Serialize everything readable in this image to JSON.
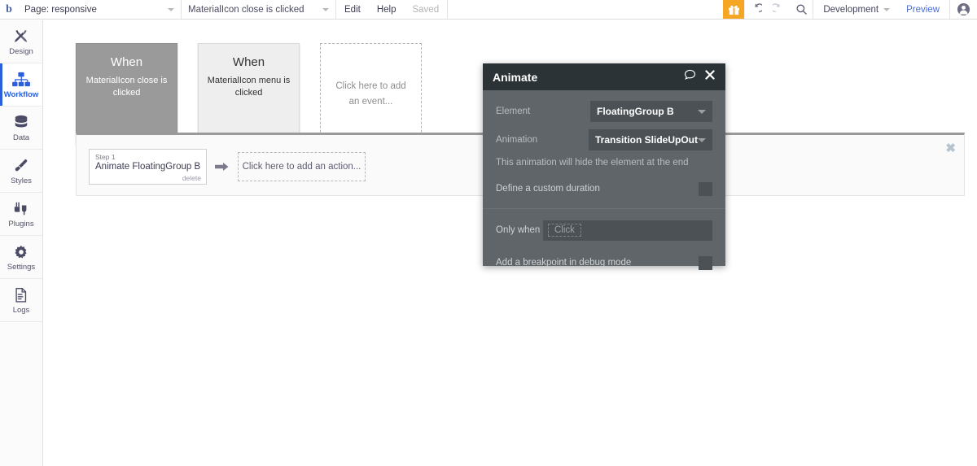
{
  "topbar": {
    "logo": "b",
    "page_select": {
      "label": "Page: responsive",
      "caret": "chevron-down-icon"
    },
    "event_select": {
      "label": "MaterialIcon close is clicked",
      "caret": "chevron-down-icon"
    },
    "edit": "Edit",
    "help": "Help",
    "saved": "Saved",
    "gift_icon": "gift-icon",
    "undo_icon": "undo-icon",
    "redo_icon": "redo-icon",
    "search_icon": "search-icon",
    "version": "Development",
    "preview": "Preview",
    "avatar_icon": "account-avatar-icon"
  },
  "sidebar": {
    "items": [
      {
        "label": "Design",
        "icon": "design-icon",
        "active": false
      },
      {
        "label": "Workflow",
        "icon": "workflow-icon",
        "active": true
      },
      {
        "label": "Data",
        "icon": "data-icon",
        "active": false
      },
      {
        "label": "Styles",
        "icon": "styles-icon",
        "active": false
      },
      {
        "label": "Plugins",
        "icon": "plugins-icon",
        "active": false
      },
      {
        "label": "Settings",
        "icon": "settings-icon",
        "active": false
      },
      {
        "label": "Logs",
        "icon": "logs-icon",
        "active": false
      }
    ],
    "expand_icon": "expand-sidebar-icon"
  },
  "workflow": {
    "events": [
      {
        "when": "When",
        "description": "MaterialIcon close is clicked",
        "selected": true
      },
      {
        "when": "When",
        "description": "MaterialIcon menu is clicked",
        "selected": false
      }
    ],
    "add_event_placeholder": "Click here to add an event...",
    "actions": {
      "step_number": "Step 1",
      "step_title": "Animate FloatingGroup B",
      "delete_label": "delete",
      "arrow_icon": "arrow-right-icon",
      "add_action_placeholder": "Click here to add an action...",
      "close_icon": "close-icon"
    }
  },
  "animate_popup": {
    "title": "Animate",
    "comment_icon": "comment-bubble-icon",
    "close_icon": "close-icon",
    "element_label": "Element",
    "element_value": "FloatingGroup B",
    "animation_label": "Animation",
    "animation_value": "Transition SlideUpOut",
    "hint": "This animation will hide the element at the end",
    "custom_duration_label": "Define a custom duration",
    "custom_duration_checked": false,
    "only_when_label": "Only when",
    "only_when_value": "Click",
    "breakpoint_label": "Add a breakpoint in debug mode",
    "breakpoint_checked": false
  },
  "colors": {
    "accent_blue": "#2b5edb",
    "gift_orange": "#f5a623",
    "preview_link": "#4a6bd8",
    "popup_header": "#2c3337",
    "popup_body": "#5f6569",
    "selected_card": "#9a9a9a"
  }
}
